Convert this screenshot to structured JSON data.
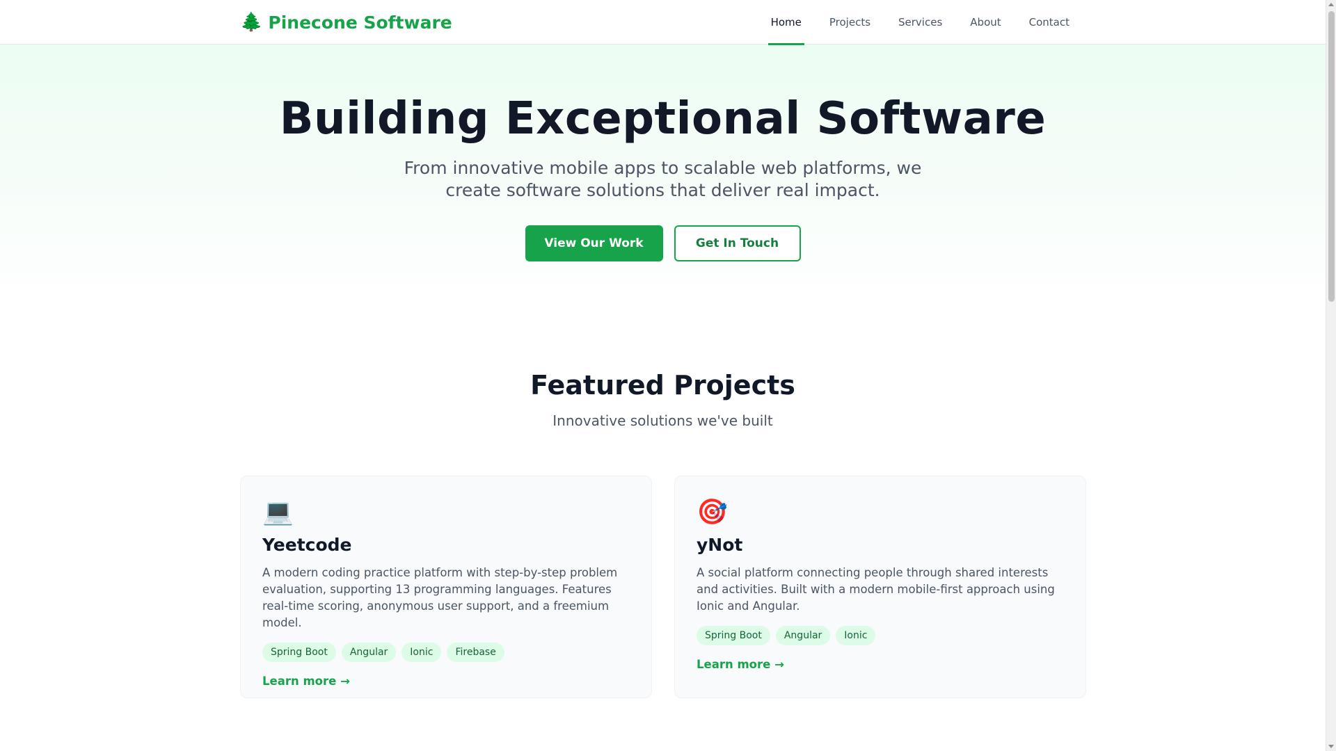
{
  "brand": {
    "name": "Pinecone Software",
    "icon": "pine-tree-icon",
    "icon_glyph": "🌲",
    "color": "#16a34a"
  },
  "nav": {
    "items": [
      {
        "label": "Home",
        "active": true
      },
      {
        "label": "Projects",
        "active": false
      },
      {
        "label": "Services",
        "active": false
      },
      {
        "label": "About",
        "active": false
      },
      {
        "label": "Contact",
        "active": false
      }
    ]
  },
  "hero": {
    "title": "Building Exceptional Software",
    "subtitle": "From innovative mobile apps to scalable web platforms, we create software solutions that deliver real impact.",
    "primary_button": "View Our Work",
    "secondary_button": "Get In Touch"
  },
  "featured": {
    "title": "Featured Projects",
    "subtitle": "Innovative solutions we've built",
    "projects": [
      {
        "icon": "laptop-icon",
        "icon_glyph": "💻",
        "name": "Yeetcode",
        "description": "A modern coding practice platform with step-by-step problem evaluation, supporting 13 programming languages. Features real-time scoring, anonymous user support, and a freemium model.",
        "tags": [
          "Spring Boot",
          "Angular",
          "Ionic",
          "Firebase"
        ],
        "link": "Learn more →"
      },
      {
        "icon": "target-icon",
        "icon_glyph": "🎯",
        "name": "yNot",
        "description": "A social platform connecting people through shared interests and activities. Built with a modern mobile-first approach using Ionic and Angular.",
        "tags": [
          "Spring Boot",
          "Angular",
          "Ionic"
        ],
        "link": "Learn more →"
      }
    ]
  }
}
